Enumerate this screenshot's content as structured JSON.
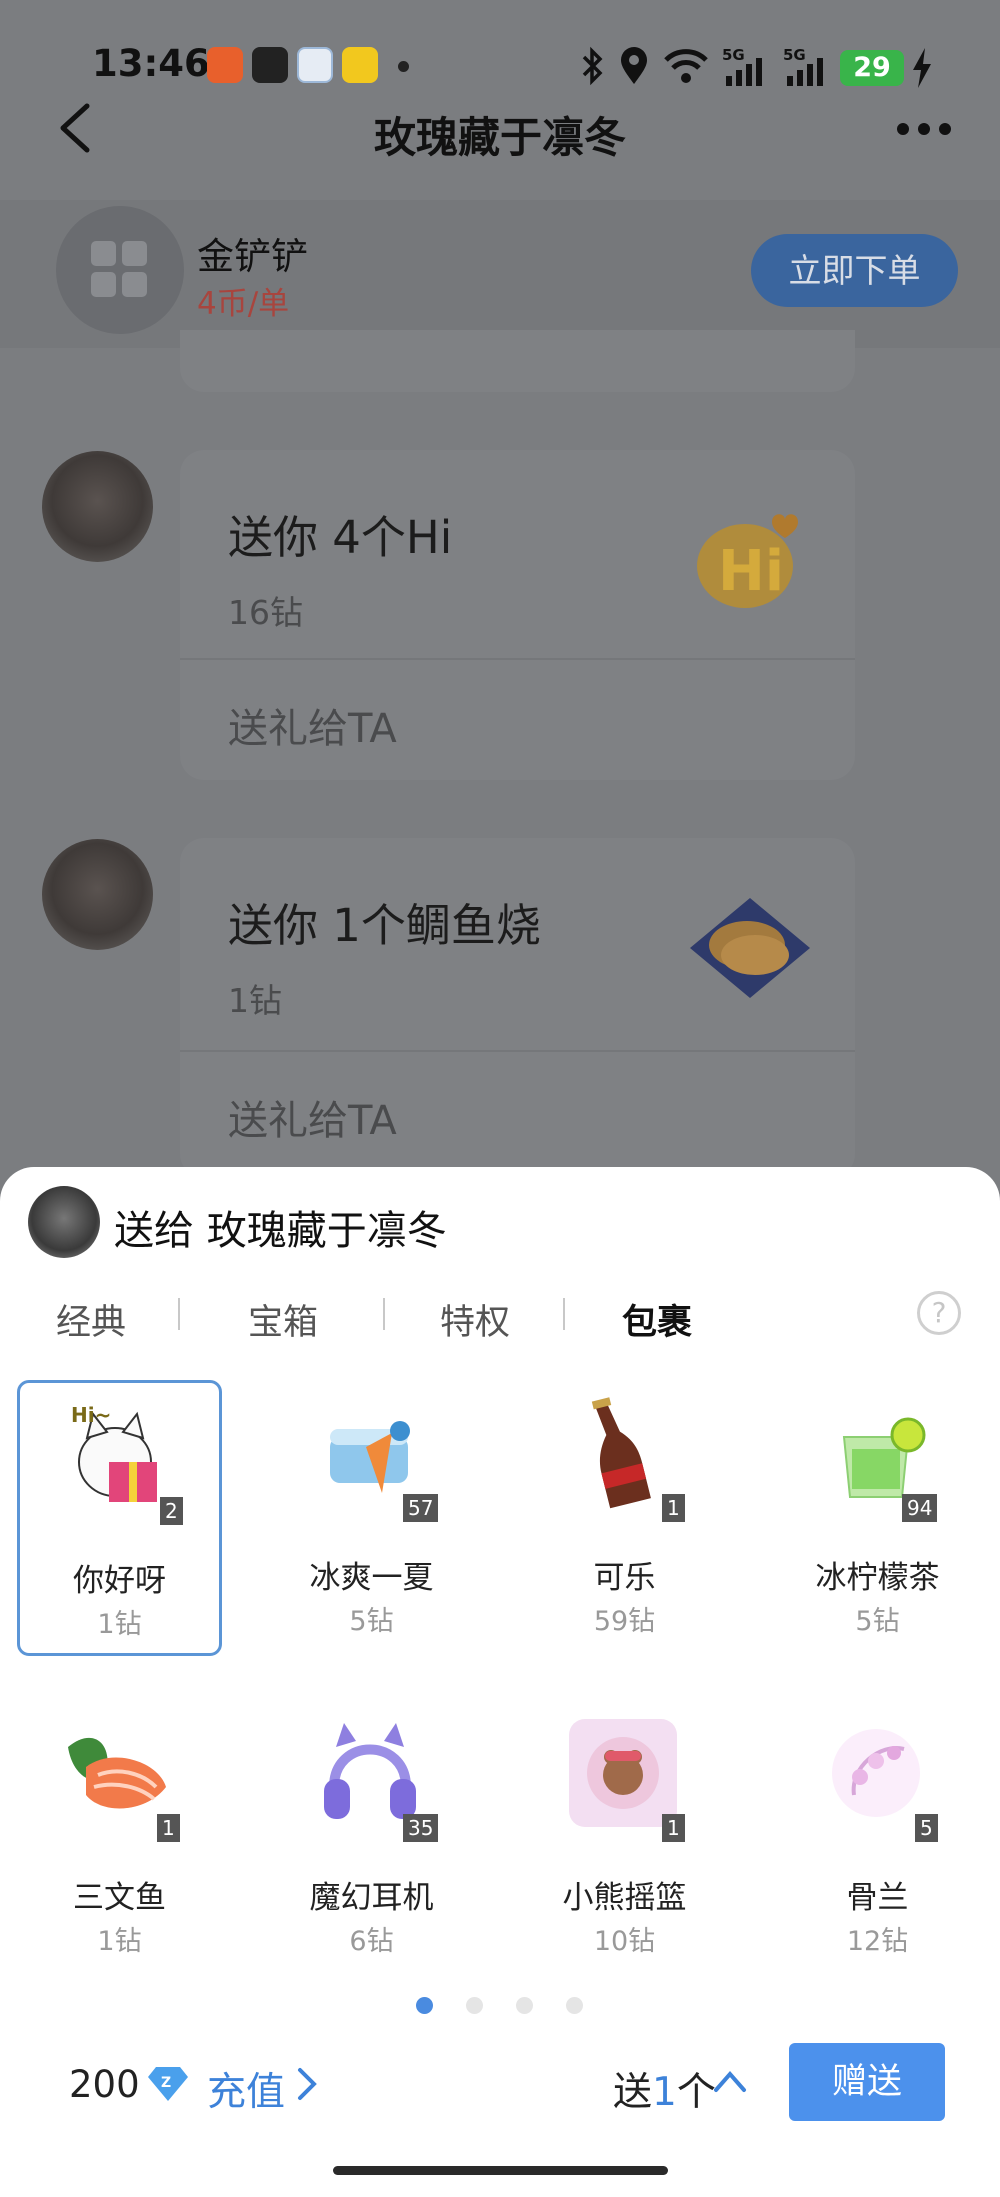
{
  "status_bar": {
    "time": "13:46",
    "signal_label": "5G",
    "battery": "29"
  },
  "nav": {
    "title": "玫瑰藏于凛冬"
  },
  "service": {
    "name": "金铲铲",
    "price": "4币/单",
    "order_button": "立即下单"
  },
  "chat": [
    {
      "title": "送你 4个Hi",
      "sub": "16钻",
      "action": "送礼给TA",
      "gift_icon": "hi-balloon-icon"
    },
    {
      "title": "送你 1个鲷鱼烧",
      "sub": "1钻",
      "action": "送礼给TA",
      "gift_icon": "taiyaki-icon"
    }
  ],
  "sheet": {
    "title": "送给 玫瑰藏于凛冬",
    "tabs": [
      "经典",
      "宝箱",
      "特权",
      "包裹"
    ],
    "active_tab": "包裹",
    "gifts": [
      {
        "name": "你好呀",
        "price": "1钻",
        "count": "2",
        "icon": "hello-cat-icon"
      },
      {
        "name": "冰爽一夏",
        "price": "5钻",
        "count": "57",
        "icon": "ice-cream-icon"
      },
      {
        "name": "可乐",
        "price": "59钻",
        "count": "1",
        "icon": "cola-icon"
      },
      {
        "name": "冰柠檬茶",
        "price": "5钻",
        "count": "94",
        "icon": "lemon-tea-icon"
      },
      {
        "name": "三文鱼",
        "price": "1钻",
        "count": "1",
        "icon": "salmon-icon"
      },
      {
        "name": "魔幻耳机",
        "price": "6钻",
        "count": "35",
        "icon": "headphones-icon"
      },
      {
        "name": "小熊摇篮",
        "price": "10钻",
        "count": "1",
        "icon": "bear-cradle-icon"
      },
      {
        "name": "骨兰",
        "price": "12钻",
        "count": "5",
        "icon": "orchid-icon"
      }
    ],
    "page_count": 4,
    "active_page": 1,
    "balance": "200",
    "recharge": "充值",
    "send_prefix": "送",
    "send_qty": "1",
    "send_suffix": "个",
    "send_button": "赠送"
  },
  "colors": {
    "accent": "#4c91ec",
    "price_red": "#a8453e",
    "overlay": "#7b7d80"
  }
}
